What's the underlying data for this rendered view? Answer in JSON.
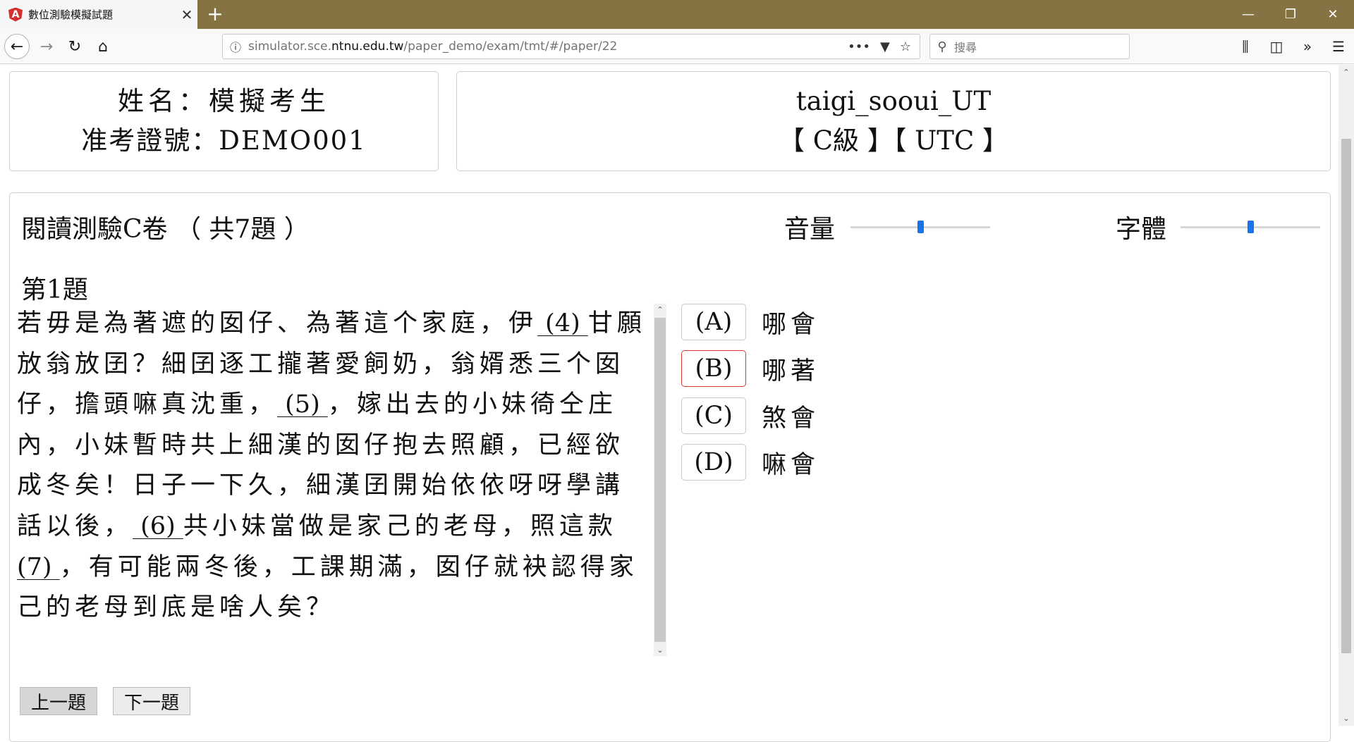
{
  "browser": {
    "tab_title": "數位測驗模擬試題",
    "tab_close": "✕",
    "new_tab": "+",
    "url_prefix": "simulator.sce.",
    "url_host": "ntnu.edu.tw",
    "url_path": "/paper_demo/exam/tmt/#/paper/22",
    "search_placeholder": "搜尋"
  },
  "candidate": {
    "name_line": "姓名：模擬考生",
    "id_line": "准考證號：DEMO001"
  },
  "exam": {
    "code": "taigi_sooui_UT",
    "level_line": "【 C級 】【 UTC 】"
  },
  "section": {
    "title": "閱讀測驗C卷 （ 共7題 ）",
    "volume_label": "音量",
    "volume_level": 0.5,
    "font_label": "字體",
    "font_level": 0.5
  },
  "question": {
    "number": "第1題",
    "passage": {
      "p1": "若毋是為著遮的囡仔、為著這个家庭，伊",
      "b4": " (4) ",
      "p2": "甘願放翁放囝？細囝逐工攏著愛飼奶，翁婿悉三个囡仔，擔頭嘛真沈重，",
      "b5": " (5) ",
      "p3": "，嫁出去的小妹徛仝庄內，小妹暫時共上細漢的囡仔抱去照顧，已經欲成冬矣！日子一下久，細漢囝開始依依呀呀學講話以後，",
      "b6": " (6) ",
      "p4": "共小妹當做是家己的老母，照這款",
      "b7": " (7) ",
      "p5": "，有可能兩冬後，工課期滿，囡仔就袂認得家己的老母到底是啥人矣？"
    },
    "options": [
      {
        "label": "(A)",
        "text": "哪會"
      },
      {
        "label": "(B)",
        "text": "哪著"
      },
      {
        "label": "(C)",
        "text": "煞會"
      },
      {
        "label": "(D)",
        "text": "嘛會"
      }
    ],
    "selected_option": "(B)"
  },
  "navigation": {
    "prev_label": "上一題",
    "next_label": "下一題"
  }
}
